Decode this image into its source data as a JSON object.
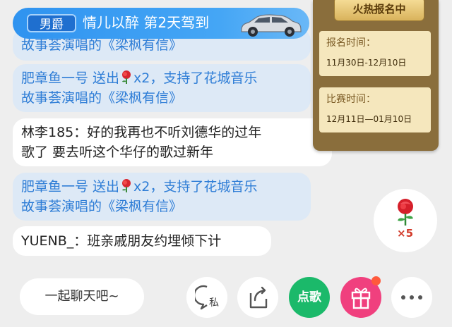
{
  "banner": {
    "badge": "男爵",
    "text": "情儿以醉  第2天驾到"
  },
  "messages": [
    {
      "type": "gift",
      "lines": [
        "故事荟演唱的《梁枫有信》"
      ]
    },
    {
      "type": "gift",
      "line1_pre": "肥章鱼一号 送出",
      "line1_post": "x2，支持了花城音乐",
      "line2": "故事荟演唱的《梁枫有信》"
    },
    {
      "type": "user",
      "line1": "林李185：好的我再也不听刘德华的过年",
      "line2": "歌了 要去听这个华仔的歌过新年"
    },
    {
      "type": "gift",
      "line1_pre": "肥章鱼一号 送出",
      "line1_post": "x2，支持了花城音乐",
      "line2": "故事荟演唱的《梁枫有信》"
    },
    {
      "type": "user",
      "line1": "YUENB_：班亲戚朋友约埋倾下计"
    }
  ],
  "panel": {
    "ribbon": "火热报名中",
    "registration_label": "报名时间：",
    "registration_value": "11月30日-12月10日",
    "contest_label": "比赛时间：",
    "contest_value": "12月11日—01月10日"
  },
  "rose_gift": {
    "count": "×5"
  },
  "bottom_bar": {
    "chat_placeholder": "一起聊天吧~",
    "private_label": "私",
    "song_label": "点歌"
  },
  "colors": {
    "gift_text": "#2e7dd6",
    "banner": "#2f93f0",
    "song_button": "#1bb96a",
    "gift_button": "#f0407e",
    "panel": "#8a6e3c"
  }
}
